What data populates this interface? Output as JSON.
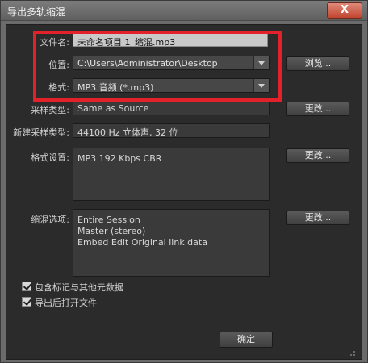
{
  "window": {
    "title": "导出多轨缩混",
    "close_glyph": "X"
  },
  "fields": {
    "filename": {
      "label": "文件名:",
      "value": "未命名项目 1_缩混.mp3"
    },
    "location": {
      "label": "位置:",
      "value": "C:\\Users\\Administrator\\Desktop"
    },
    "format": {
      "label": "格式:",
      "value": "MP3 音频 (*.mp3)"
    },
    "sample_type": {
      "label": "采样类型:",
      "value": "Same as Source"
    },
    "new_sample_type": {
      "label": "新建采样类型:",
      "value": "44100 Hz 立体声, 32 位"
    },
    "format_settings": {
      "label": "格式设置:",
      "value": "MP3 192 Kbps CBR"
    },
    "mixdown_options": {
      "label": "缩混选项:",
      "lines": [
        "Entire Session",
        "Master (stereo)",
        "Embed Edit Original link data"
      ]
    }
  },
  "buttons": {
    "browse": "浏览...",
    "change_sample": "更改...",
    "change_format": "更改...",
    "change_mixdown": "更改...",
    "ok": "确定"
  },
  "checkboxes": [
    {
      "label": "包含标记与其他元数据",
      "checked": true
    },
    {
      "label": "导出后打开文件",
      "checked": true
    }
  ],
  "colors": {
    "highlight": "#e3212b",
    "close": "#c0452f"
  }
}
